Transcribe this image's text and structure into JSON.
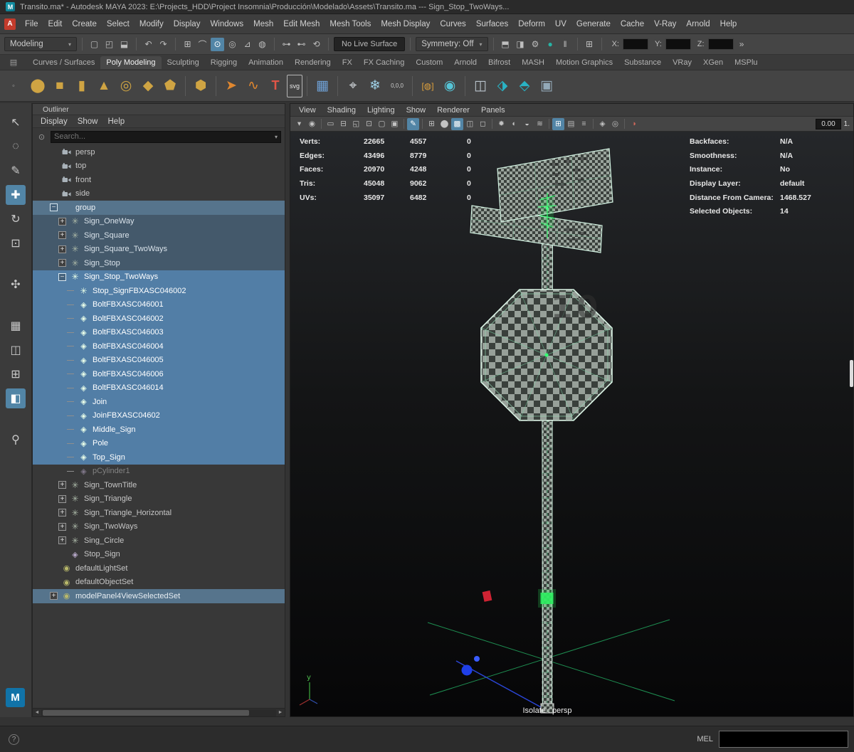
{
  "title_bar": {
    "title": "Transito.ma* - Autodesk MAYA 2023: E:\\Projects_HDD\\Project Insomnia\\Producción\\Modelado\\Assets\\Transito.ma --- Sign_Stop_TwoWays..."
  },
  "menu_bar": {
    "items": [
      "File",
      "Edit",
      "Create",
      "Select",
      "Modify",
      "Display",
      "Windows",
      "Mesh",
      "Edit Mesh",
      "Mesh Tools",
      "Mesh Display",
      "Curves",
      "Surfaces",
      "Deform",
      "UV",
      "Generate",
      "Cache",
      "V-Ray",
      "Arnold",
      "Help"
    ]
  },
  "status_line": {
    "mode": "Modeling",
    "live_surface": "No Live Surface",
    "symmetry": "Symmetry: Off",
    "x_label": "X:",
    "y_label": "Y:",
    "z_label": "Z:",
    "accent_color": "#5285a6",
    "icons_a": [
      {
        "sep": true
      },
      {
        "name": "new-scene-icon",
        "glyph": "▢"
      },
      {
        "name": "open-scene-icon",
        "glyph": "◰"
      },
      {
        "name": "save-scene-icon",
        "glyph": "⬓"
      },
      {
        "sep": true
      },
      {
        "name": "undo-icon",
        "glyph": "↶"
      },
      {
        "name": "redo-icon",
        "glyph": "↷"
      },
      {
        "sep": true
      },
      {
        "name": "snap-grid-icon",
        "glyph": "⊞"
      },
      {
        "name": "snap-curve-icon",
        "glyph": "⌒"
      },
      {
        "name": "snap-point-icon",
        "glyph": "⊙",
        "active": true
      },
      {
        "name": "snap-projected-icon",
        "glyph": "◎"
      },
      {
        "name": "snap-plane-icon",
        "glyph": "⊿"
      },
      {
        "name": "make-live-icon",
        "glyph": "◍"
      },
      {
        "sep": true
      },
      {
        "name": "input-connections-icon",
        "glyph": "⊶"
      },
      {
        "name": "output-connections-icon",
        "glyph": "⊷"
      },
      {
        "name": "history-toggle-icon",
        "glyph": "⟲"
      },
      {
        "sep": true
      }
    ],
    "icons_b": [
      {
        "sep": true
      },
      {
        "name": "render-current-frame-icon",
        "glyph": "⬒"
      },
      {
        "name": "ipr-render-icon",
        "glyph": "◨"
      },
      {
        "name": "render-settings-icon",
        "glyph": "⚙"
      },
      {
        "name": "arnold-ipr-icon",
        "glyph": "●",
        "color": "#27b3a4"
      },
      {
        "name": "pause-viewport-icon",
        "glyph": "‖"
      },
      {
        "sep": true
      },
      {
        "name": "grid-options-icon",
        "glyph": "⊞"
      },
      {
        "sep": true
      }
    ],
    "expand_glyph": "»"
  },
  "shelf": {
    "tabs": [
      "Curves / Surfaces",
      "Poly Modeling",
      "Sculpting",
      "Rigging",
      "Animation",
      "Rendering",
      "FX",
      "FX Caching",
      "Custom",
      "Arnold",
      "Bifrost",
      "MASH",
      "Motion Graphics",
      "Substance",
      "VRay",
      "XGen",
      "MSPlu"
    ],
    "active_tab": "Poly Modeling",
    "rail_glyph": "▤",
    "icons": [
      {
        "name": "poly-sphere-icon",
        "glyph": "⬤",
        "color": "#cfa443"
      },
      {
        "name": "poly-cube-icon",
        "glyph": "■",
        "color": "#cfa443"
      },
      {
        "name": "poly-cylinder-icon",
        "glyph": "▮",
        "color": "#cfa443"
      },
      {
        "name": "poly-cone-icon",
        "glyph": "▲",
        "color": "#cfa443"
      },
      {
        "name": "poly-torus-icon",
        "glyph": "◎",
        "color": "#cfa443"
      },
      {
        "name": "poly-plane-icon",
        "glyph": "◆",
        "color": "#cfa443"
      },
      {
        "name": "poly-pyramid-icon",
        "glyph": "⬟",
        "color": "#cfa443"
      },
      {
        "sep": true
      },
      {
        "name": "platonic-solid-icon",
        "glyph": "⬢",
        "color": "#cfa443"
      },
      {
        "sep": true
      },
      {
        "name": "curve-tool-icon",
        "glyph": "➤",
        "color": "#e0872f"
      },
      {
        "name": "pencil-curve-icon",
        "glyph": "∿",
        "color": "#e0872f"
      },
      {
        "name": "type-tool-icon",
        "glyph": "T",
        "color": "#e05547",
        "cls": "bold"
      },
      {
        "name": "svg-tool-icon",
        "glyph": "svg",
        "cls": "badge"
      },
      {
        "sep": true
      },
      {
        "name": "uv-editor-icon",
        "glyph": "▦",
        "color": "#6e9fd4"
      },
      {
        "sep": true
      },
      {
        "name": "center-pivot-icon",
        "glyph": "⌖",
        "color": "#d8dde2"
      },
      {
        "name": "snap-together-icon",
        "glyph": "❄",
        "color": "#9fd2e8"
      },
      {
        "name": "zero-transform-icon",
        "glyph": "0,0,0",
        "cls": "tinytext"
      },
      {
        "sep": true
      },
      {
        "name": "paint-selection-icon",
        "glyph": "[◍]",
        "color": "#e0a23c",
        "cls": "smalltext"
      },
      {
        "name": "soft-select-icon",
        "glyph": "◉",
        "color": "#56c4d6"
      },
      {
        "sep": true
      },
      {
        "name": "mirror-geometry-icon",
        "glyph": "◫",
        "color": "#bac4cc"
      },
      {
        "name": "combine-icon",
        "glyph": "⬗",
        "color": "#29b2c4"
      },
      {
        "name": "separate-icon",
        "glyph": "⬘",
        "color": "#29b2c4"
      },
      {
        "name": "boolean-icon",
        "glyph": "▣",
        "color": "#93a9b8"
      }
    ]
  },
  "toolbox": {
    "tools": [
      {
        "name": "select-tool-icon",
        "glyph": "↖"
      },
      {
        "name": "lasso-tool-icon",
        "glyph": "◌"
      },
      {
        "name": "paint-select-tool-icon",
        "glyph": "✎"
      },
      {
        "name": "move-tool-icon",
        "glyph": "✚",
        "active": true
      },
      {
        "name": "rotate-tool-icon",
        "glyph": "↻"
      },
      {
        "name": "scale-tool-icon",
        "glyph": "⊡"
      },
      {
        "sep": true
      },
      {
        "name": "rig-pose-icon",
        "glyph": "✣"
      },
      {
        "sep": true
      },
      {
        "name": "layout-single-pane-icon",
        "glyph": "▦"
      },
      {
        "name": "layout-two-pane-icon",
        "glyph": "◫"
      },
      {
        "name": "layout-four-pane-icon",
        "glyph": "⊞"
      },
      {
        "name": "layout-outliner-pane-icon",
        "glyph": "◧",
        "active": true
      },
      {
        "sep": true
      },
      {
        "name": "zoom-tool-icon",
        "glyph": "⚲"
      }
    ]
  },
  "outliner": {
    "title": "Outliner",
    "menus": [
      "Display",
      "Show",
      "Help"
    ],
    "search_placeholder": "Search...",
    "selection_color": "#527ea6",
    "items": [
      {
        "label": "persp",
        "indent": 0,
        "icon": "camera",
        "exp": "none",
        "state": "normal"
      },
      {
        "label": "top",
        "indent": 0,
        "icon": "camera",
        "exp": "none",
        "state": "normal"
      },
      {
        "label": "front",
        "indent": 0,
        "icon": "camera",
        "exp": "none",
        "state": "normal"
      },
      {
        "label": "side",
        "indent": 0,
        "icon": "camera",
        "exp": "none",
        "state": "normal"
      },
      {
        "label": "group",
        "indent": 0,
        "icon": "blank",
        "exp": "minus",
        "state": "ancestor"
      },
      {
        "label": "Sign_OneWay",
        "indent": 1,
        "icon": "transform",
        "exp": "plus",
        "state": "tinted"
      },
      {
        "label": "Sign_Square",
        "indent": 1,
        "icon": "transform",
        "exp": "plus",
        "state": "tinted"
      },
      {
        "label": "Sign_Square_TwoWays",
        "indent": 1,
        "icon": "transform",
        "exp": "plus",
        "state": "tinted"
      },
      {
        "label": "Sign_Stop",
        "indent": 1,
        "icon": "transform",
        "exp": "plus",
        "state": "tinted"
      },
      {
        "label": "Sign_Stop_TwoWays",
        "indent": 1,
        "icon": "transform",
        "exp": "minus",
        "state": "selected"
      },
      {
        "label": "Stop_SignFBXASC046002",
        "indent": 2,
        "icon": "transform",
        "exp": "line",
        "state": "selected"
      },
      {
        "label": "BoltFBXASC046001",
        "indent": 2,
        "icon": "mesh",
        "exp": "line",
        "state": "selected"
      },
      {
        "label": "BoltFBXASC046002",
        "indent": 2,
        "icon": "mesh",
        "exp": "line",
        "state": "selected"
      },
      {
        "label": "BoltFBXASC046003",
        "indent": 2,
        "icon": "mesh",
        "exp": "line",
        "state": "selected"
      },
      {
        "label": "BoltFBXASC046004",
        "indent": 2,
        "icon": "mesh",
        "exp": "line",
        "state": "selected"
      },
      {
        "label": "BoltFBXASC046005",
        "indent": 2,
        "icon": "mesh",
        "exp": "line",
        "state": "selected"
      },
      {
        "label": "BoltFBXASC046006",
        "indent": 2,
        "icon": "mesh",
        "exp": "line",
        "state": "selected"
      },
      {
        "label": "BoltFBXASC046014",
        "indent": 2,
        "icon": "mesh",
        "exp": "line",
        "state": "selected"
      },
      {
        "label": "Join",
        "indent": 2,
        "icon": "mesh",
        "exp": "line",
        "state": "selected"
      },
      {
        "label": "JoinFBXASC04602",
        "indent": 2,
        "icon": "mesh",
        "exp": "line",
        "state": "selected"
      },
      {
        "label": "Middle_Sign",
        "indent": 2,
        "icon": "mesh",
        "exp": "line",
        "state": "selected"
      },
      {
        "label": "Pole",
        "indent": 2,
        "icon": "mesh",
        "exp": "line",
        "state": "selected"
      },
      {
        "label": "Top_Sign",
        "indent": 2,
        "icon": "mesh",
        "exp": "line",
        "state": "selected"
      },
      {
        "label": "pCylinder1",
        "indent": 2,
        "icon": "mesh",
        "exp": "line",
        "state": "dim"
      },
      {
        "label": "Sign_TownTitle",
        "indent": 1,
        "icon": "transform",
        "exp": "plus",
        "state": "normal"
      },
      {
        "label": "Sign_Triangle",
        "indent": 1,
        "icon": "transform",
        "exp": "plus",
        "state": "normal"
      },
      {
        "label": "Sign_Triangle_Horizontal",
        "indent": 1,
        "icon": "transform",
        "exp": "plus",
        "state": "normal"
      },
      {
        "label": "Sign_TwoWays",
        "indent": 1,
        "icon": "transform",
        "exp": "plus",
        "state": "normal"
      },
      {
        "label": "Sing_Circle",
        "indent": 1,
        "icon": "transform",
        "exp": "plus",
        "state": "normal"
      },
      {
        "label": "Stop_Sign",
        "indent": 1,
        "icon": "mesh",
        "exp": "none",
        "state": "normal"
      },
      {
        "label": "defaultLightSet",
        "indent": 0,
        "icon": "set",
        "exp": "none",
        "state": "normal"
      },
      {
        "label": "defaultObjectSet",
        "indent": 0,
        "icon": "set",
        "exp": "none",
        "state": "normal"
      },
      {
        "label": "modelPanel4ViewSelectedSet",
        "indent": 0,
        "icon": "set",
        "exp": "plus",
        "state": "sethl"
      }
    ]
  },
  "viewport": {
    "menus": [
      "View",
      "Shading",
      "Lighting",
      "Show",
      "Renderer",
      "Panels"
    ],
    "toolbar_icons": [
      {
        "name": "camera-select-icon",
        "glyph": "▾"
      },
      {
        "name": "camera-lock-icon",
        "glyph": "◉"
      },
      {
        "sep": true
      },
      {
        "name": "film-gate-icon",
        "glyph": "▭"
      },
      {
        "name": "resolution-gate-icon",
        "glyph": "⊟"
      },
      {
        "name": "gate-mask-icon",
        "glyph": "◱"
      },
      {
        "name": "field-chart-icon",
        "glyph": "⊡"
      },
      {
        "name": "safe-action-icon",
        "glyph": "▢"
      },
      {
        "name": "safe-title-icon",
        "glyph": "▣"
      },
      {
        "sep": true
      },
      {
        "name": "isolate-select-icon",
        "glyph": "✎",
        "active": true
      },
      {
        "sep": true
      },
      {
        "name": "wireframe-mode-icon",
        "glyph": "⊞"
      },
      {
        "name": "shaded-mode-icon",
        "glyph": "⬤"
      },
      {
        "name": "textured-mode-icon",
        "glyph": "▩",
        "active": true
      },
      {
        "name": "use-default-material-icon",
        "glyph": "◫"
      },
      {
        "name": "xray-icon",
        "glyph": "◻"
      },
      {
        "sep": true
      },
      {
        "name": "lighting-icon",
        "glyph": "✹"
      },
      {
        "name": "shadows-icon",
        "glyph": "◐"
      },
      {
        "name": "ambient-occlusion-icon",
        "glyph": "◒"
      },
      {
        "name": "motion-blur-icon",
        "glyph": "≋"
      },
      {
        "sep": true
      },
      {
        "name": "grid-display-icon",
        "glyph": "⊞",
        "active": true
      },
      {
        "name": "hud-display-icon",
        "glyph": "▤"
      },
      {
        "name": "object-details-icon",
        "glyph": "≡"
      },
      {
        "sep": true
      },
      {
        "name": "viewport-renderer-icon",
        "glyph": "◈"
      },
      {
        "name": "stereo-icon",
        "glyph": "◎"
      },
      {
        "sep": true
      },
      {
        "name": "exposure-icon",
        "glyph": "◑",
        "color": "#d0685a"
      }
    ],
    "exposure_value": "0.00",
    "gamma_value": "1.",
    "hud_left": [
      {
        "label": "Verts:",
        "v1": "22665",
        "v2": "4557",
        "v3": "0"
      },
      {
        "label": "Edges:",
        "v1": "43496",
        "v2": "8779",
        "v3": "0"
      },
      {
        "label": "Faces:",
        "v1": "20970",
        "v2": "4248",
        "v3": "0"
      },
      {
        "label": "Tris:",
        "v1": "45048",
        "v2": "9062",
        "v3": "0"
      },
      {
        "label": "UVs:",
        "v1": "35097",
        "v2": "6482",
        "v3": "0"
      }
    ],
    "hud_right": [
      {
        "label": "Backfaces:",
        "value": "N/A"
      },
      {
        "label": "Smoothness:",
        "value": "N/A"
      },
      {
        "label": "Instance:",
        "value": "No"
      },
      {
        "label": "Display Layer:",
        "value": "default"
      },
      {
        "label": "Distance From Camera:",
        "value": "1468.527"
      },
      {
        "label": "Selected Objects:",
        "value": "14"
      }
    ],
    "sign_text": "10",
    "isolate_label": "Isolate : persp",
    "wireframe_color": "#d9f2e4",
    "selection_highlight_color": "#38ff74"
  },
  "command_line": {
    "label": "MEL"
  }
}
